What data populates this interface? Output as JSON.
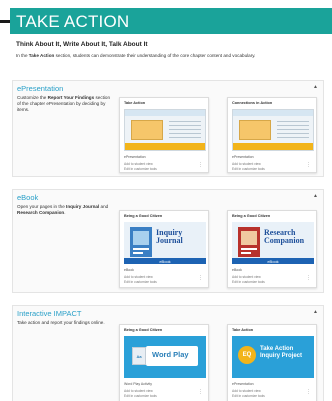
{
  "header": {
    "title": "TAKE ACTION"
  },
  "subhead": "Think About It, Write About It, Talk About It",
  "intro": {
    "prefix": "In the ",
    "bold": "Take Action",
    "suffix": " section, students can demonstrate their understanding of the core chapter content and vocabulary."
  },
  "sections": [
    {
      "title": "ePresentation",
      "desc_prefix": "Customize the ",
      "desc_bold": "Report Your Findings",
      "desc_suffix": " section of the chapter ePresentation by deciding by items.",
      "cards": [
        {
          "title": "Take Action",
          "tag": "ePresentation",
          "meta1": "Add to student view",
          "meta2": "Edit in customize tools"
        },
        {
          "title": "Connections in Action",
          "tag": "ePresentation",
          "meta1": "Add to student view",
          "meta2": "Edit in customize tools"
        }
      ]
    },
    {
      "title": "eBook",
      "desc_prefix": "Open your pages in the ",
      "desc_bold": "Inquiry Journal",
      "desc_mid": " and ",
      "desc_bold2": "Research Companion",
      "desc_suffix": ".",
      "cards": [
        {
          "title": "Being a Good Citizen",
          "book_title": "Inquiry Journal",
          "bar": "eBook",
          "tag": "eBook",
          "meta1": "Add to student view",
          "meta2": "Edit in customize tools"
        },
        {
          "title": "Being a Good Citizen",
          "book_title": "Research Companion",
          "bar": "eBook",
          "tag": "eBook",
          "meta1": "Add to student view",
          "meta2": "Edit in customize tools"
        }
      ]
    },
    {
      "title": "Interactive IMPACT",
      "desc": "Take action and report your findings online.",
      "cards": [
        {
          "title": "Being a Good Citizen",
          "thumb_title": "Word Play",
          "tag": "Word Play Activity",
          "meta1": "Add to student view",
          "meta2": "Edit in customize tools"
        },
        {
          "title": "Take Action",
          "thumb_title": "Take Action Inquiry Project",
          "badge": "EQ",
          "tag": "ePresentation",
          "meta1": "Add to student view",
          "meta2": "Edit in customize tools"
        }
      ]
    }
  ],
  "colors": {
    "header": "#1aa39a",
    "section_title": "#2aa0c8",
    "ebook_bar": "#1d63b3",
    "impact": "#2aa0d8"
  }
}
